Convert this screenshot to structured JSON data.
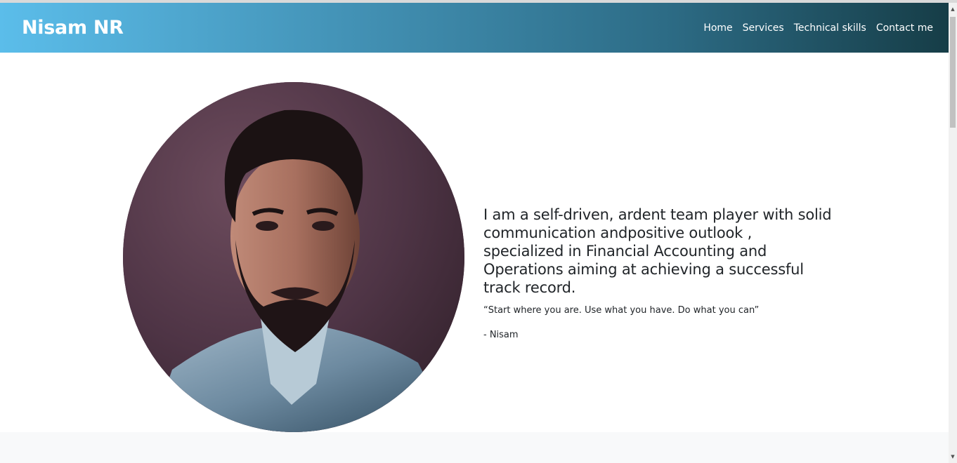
{
  "navbar": {
    "brand": "Nisam NR",
    "links": [
      "Home",
      "Services",
      "Technical skills",
      "Contact me"
    ]
  },
  "hero": {
    "headline": "I am a self-driven, ardent team player with solid communication andpositive outlook , specialized in Financial Accounting and Operations aiming at achieving a successful track record.",
    "quote": "“Start where you are. Use what you have. Do what you can”",
    "author": "- Nisam"
  },
  "colors": {
    "navbar_gradient_start": "#5bbdea",
    "navbar_gradient_end": "#163d47",
    "text": "#212529",
    "lower_band": "#f8f9fa"
  },
  "icons": {
    "scroll_up": "▲",
    "scroll_down": "▼"
  }
}
